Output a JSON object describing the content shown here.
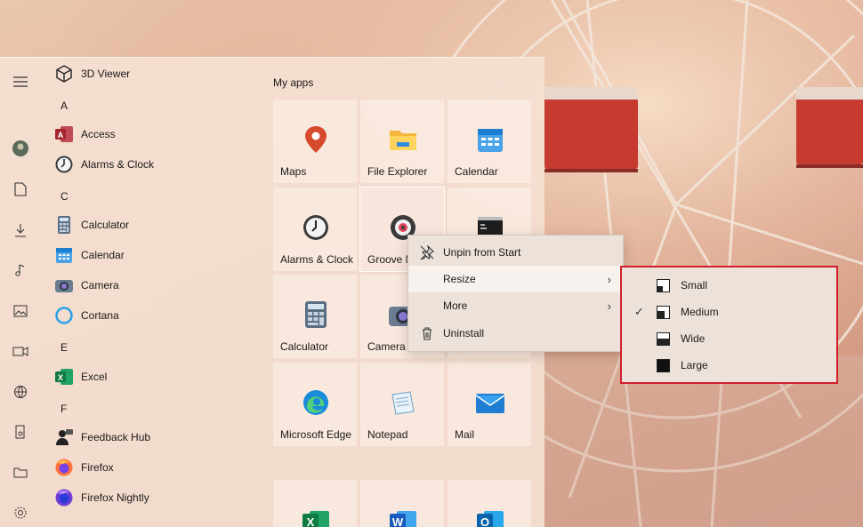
{
  "start_menu": {
    "rail": [
      "menu-icon",
      "user-avatar-icon",
      "document-icon",
      "download-icon",
      "music-icon",
      "pictures-icon",
      "videos-icon",
      "network-icon",
      "personal-folder-icon",
      "file-explorer-icon",
      "settings-icon"
    ],
    "apps": [
      {
        "label": "3D Viewer",
        "icon": "cube-icon"
      },
      {
        "letter": "A"
      },
      {
        "label": "Access",
        "icon": "access-icon"
      },
      {
        "label": "Alarms & Clock",
        "icon": "clock-icon"
      },
      {
        "letter": "C"
      },
      {
        "label": "Calculator",
        "icon": "calculator-icon"
      },
      {
        "label": "Calendar",
        "icon": "calendar-icon"
      },
      {
        "label": "Camera",
        "icon": "camera-icon"
      },
      {
        "label": "Cortana",
        "icon": "cortana-icon"
      },
      {
        "letter": "E"
      },
      {
        "label": "Excel",
        "icon": "excel-icon"
      },
      {
        "letter": "F"
      },
      {
        "label": "Feedback Hub",
        "icon": "feedback-icon"
      },
      {
        "label": "Firefox",
        "icon": "firefox-icon"
      },
      {
        "label": "Firefox Nightly",
        "icon": "firefox-nightly-icon"
      }
    ],
    "tiles_title": "My apps",
    "tiles": [
      {
        "label": "Maps",
        "icon": "maps-icon"
      },
      {
        "label": "File Explorer",
        "icon": "folder-icon"
      },
      {
        "label": "Calendar",
        "icon": "calendar-icon"
      },
      {
        "label": "Alarms & Clock",
        "icon": "clock-icon"
      },
      {
        "label": "Groove M",
        "icon": "groove-music-icon"
      },
      {
        "label": "",
        "icon": "command-prompt-icon"
      },
      {
        "label": "Calculator",
        "icon": "calculator-icon"
      },
      {
        "label": "Camera",
        "icon": "camera-icon"
      },
      {
        "label": "",
        "icon": ""
      },
      {
        "label": "Microsoft Edge",
        "icon": "edge-icon"
      },
      {
        "label": "Notepad",
        "icon": "notepad-icon"
      },
      {
        "label": "Mail",
        "icon": "mail-icon"
      },
      {
        "label": "",
        "icon": "excel-icon"
      },
      {
        "label": "",
        "icon": "word-icon"
      },
      {
        "label": "",
        "icon": "outlook-icon"
      }
    ]
  },
  "context_menu": {
    "items": [
      {
        "label": "Unpin from Start",
        "icon": "unpin-icon",
        "submenu": false
      },
      {
        "label": "Resize",
        "icon": "",
        "submenu": true
      },
      {
        "label": "More",
        "icon": "",
        "submenu": true
      },
      {
        "label": "Uninstall",
        "icon": "trash-icon",
        "submenu": false
      }
    ]
  },
  "resize_submenu": {
    "items": [
      {
        "label": "Small",
        "checked": false
      },
      {
        "label": "Medium",
        "checked": true
      },
      {
        "label": "Wide",
        "checked": false
      },
      {
        "label": "Large",
        "checked": false
      }
    ],
    "check_glyph": "✓",
    "highlight_color": "#d21f2a"
  },
  "arrow_glyph": "›"
}
